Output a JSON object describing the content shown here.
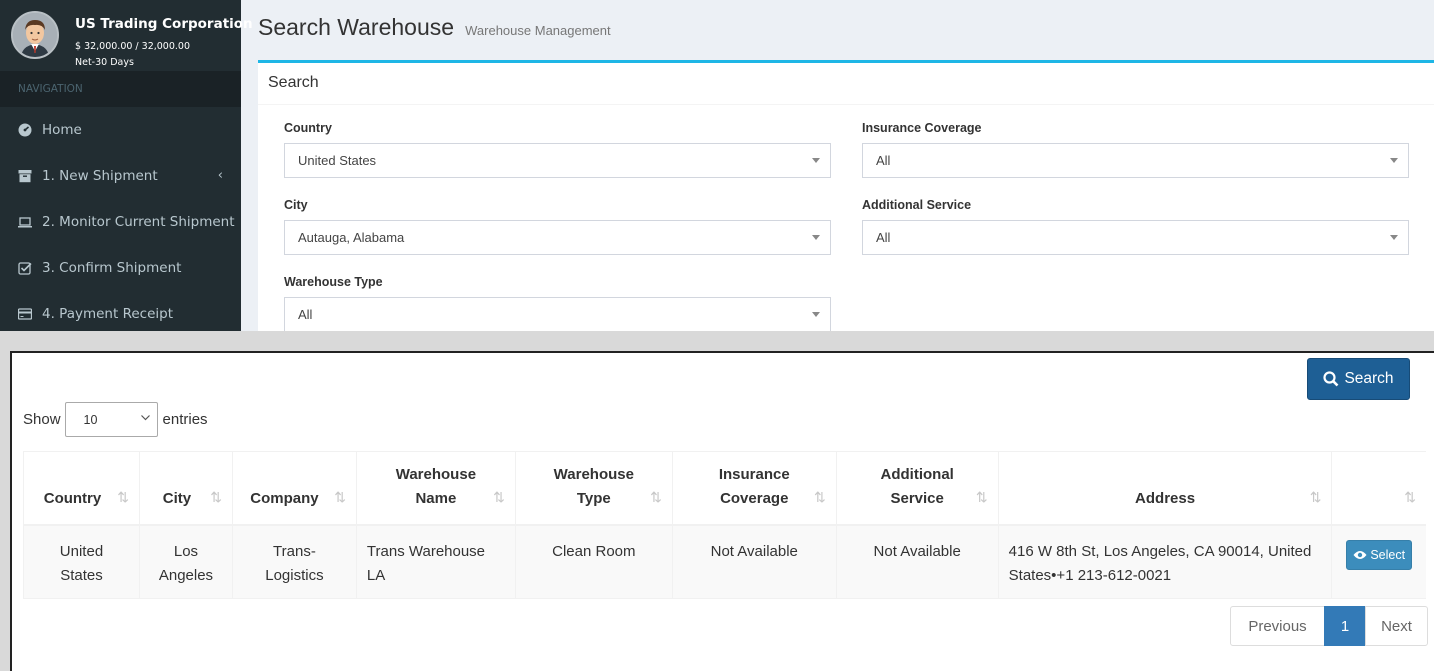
{
  "user": {
    "name": "US Trading Corporation",
    "balance": "$ 32,000.00 / 32,000.00",
    "terms": "Net-30 Days"
  },
  "nav": {
    "header": "NAVIGATION",
    "items": [
      {
        "label": "Home",
        "icon": "dashboard-icon"
      },
      {
        "label": "1. New Shipment",
        "icon": "archive-icon",
        "caret": "‹"
      },
      {
        "label": "2. Monitor Current Shipment",
        "icon": "laptop-icon"
      },
      {
        "label": "3. Confirm Shipment",
        "icon": "check-square-icon"
      },
      {
        "label": "4. Payment Receipt",
        "icon": "credit-card-icon"
      }
    ]
  },
  "page": {
    "title": "Search Warehouse",
    "subtitle": "Warehouse Management"
  },
  "search_box": {
    "title": "Search",
    "fields": {
      "country": {
        "label": "Country",
        "value": "United States"
      },
      "insurance": {
        "label": "Insurance Coverage",
        "value": "All"
      },
      "city": {
        "label": "City",
        "value": "Autauga, Alabama"
      },
      "service": {
        "label": "Additional Service",
        "value": "All"
      },
      "type": {
        "label": "Warehouse Type",
        "value": "All"
      }
    },
    "search_button": "Search"
  },
  "table": {
    "show_label": "Show",
    "entries_value": "10",
    "entries_label": "entries",
    "columns": [
      [
        "Country"
      ],
      [
        "City"
      ],
      [
        "Company"
      ],
      [
        "Warehouse",
        "Name"
      ],
      [
        "Warehouse",
        "Type"
      ],
      [
        "Insurance",
        "Coverage"
      ],
      [
        "Additional",
        "Service"
      ],
      [
        "Address"
      ],
      [
        ""
      ]
    ],
    "rows": [
      {
        "country": [
          "United",
          "States"
        ],
        "city": [
          "Los",
          "Angeles"
        ],
        "company": [
          "Trans-",
          "Logistics"
        ],
        "warehouse_name": [
          "Trans Warehouse",
          "LA"
        ],
        "warehouse_type": "Clean Room",
        "insurance": "Not Available",
        "service": "Not Available",
        "address": [
          "416 W 8th St, Los Angeles, CA 90014, United",
          "States•+1 213-612-0021"
        ],
        "action": "Select"
      }
    ]
  },
  "pagination": {
    "previous": "Previous",
    "current": "1",
    "next": "Next"
  },
  "colors": {
    "sidebar_bg": "#222d32",
    "accent": "#1eb6e6",
    "primary_button": "#1e5f95",
    "select_button": "#3c8dbc",
    "page_active": "#337ab7"
  }
}
